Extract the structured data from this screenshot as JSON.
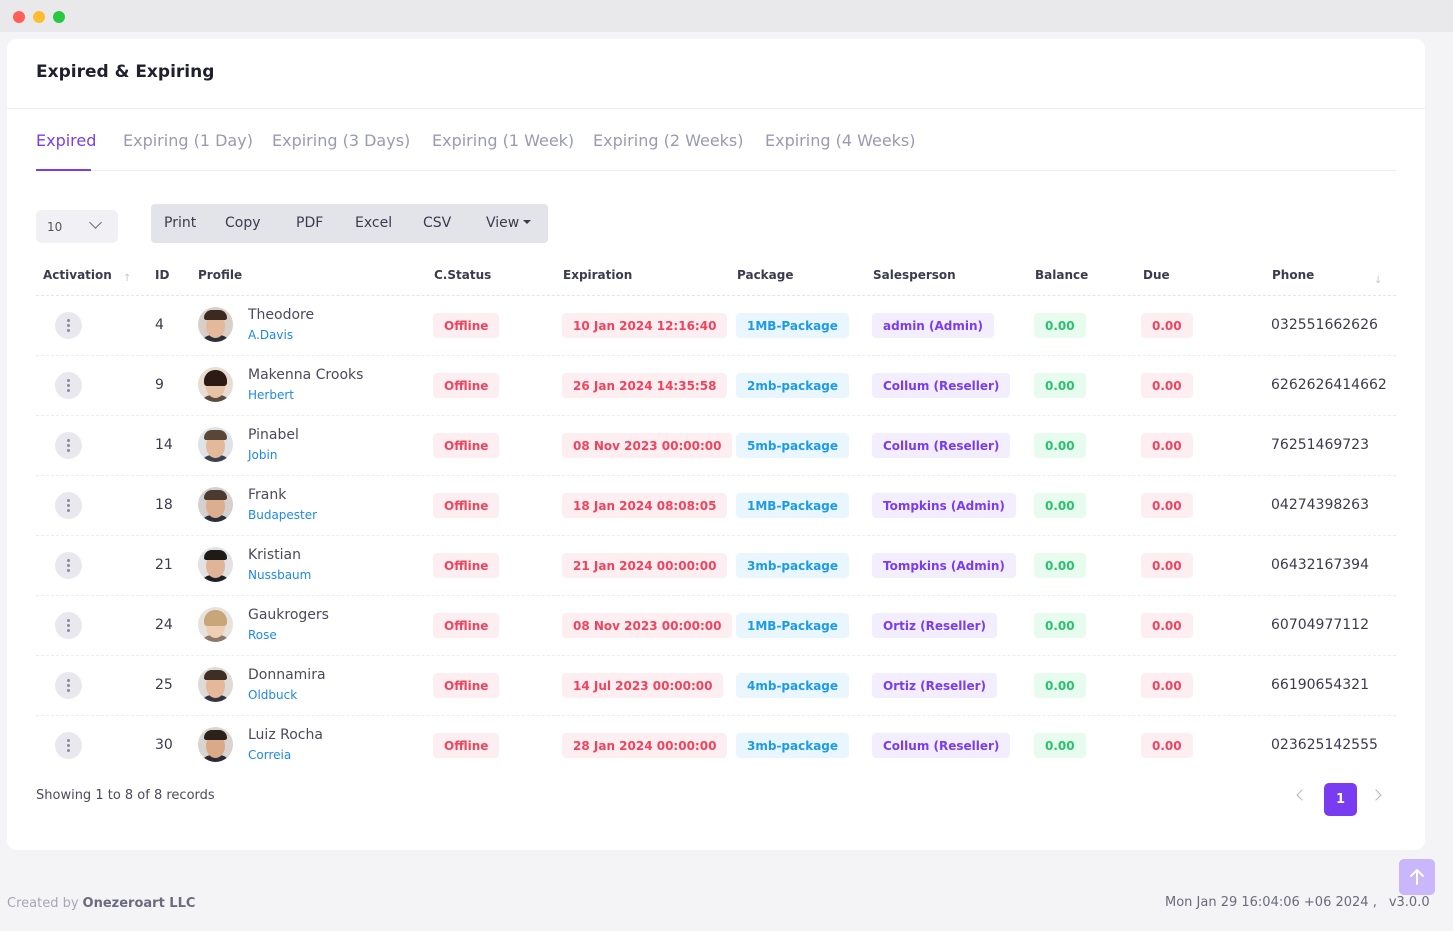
{
  "page": {
    "title": "Expired & Expiring"
  },
  "tabs": [
    {
      "label": "Expired",
      "active": true
    },
    {
      "label": "Expiring (1 Day)",
      "active": false
    },
    {
      "label": "Expiring (3 Days)",
      "active": false
    },
    {
      "label": "Expiring (1 Week)",
      "active": false
    },
    {
      "label": "Expiring (2 Weeks)",
      "active": false
    },
    {
      "label": "Expiring (4 Weeks)",
      "active": false
    }
  ],
  "toolbar": {
    "page_length": "10",
    "print_label": "Print",
    "copy_label": "Copy",
    "pdf_label": "PDF",
    "excel_label": "Excel",
    "csv_label": "CSV",
    "view_label": "View"
  },
  "table": {
    "columns": [
      "Activation",
      "ID",
      "Profile",
      "C.Status",
      "Expiration",
      "Package",
      "Salesperson",
      "Balance",
      "Due",
      "Phone"
    ],
    "rows": [
      {
        "id": "4",
        "name": "Theodore",
        "username": "A.Davis",
        "status": "Offline",
        "expiration": "10 Jan 2024 12:16:40",
        "package": "1MB-Package",
        "salesperson": "admin (Admin)",
        "balance": "0.00",
        "due": "0.00",
        "phone": "032551662626"
      },
      {
        "id": "9",
        "name": "Makenna Crooks",
        "username": "Herbert",
        "status": "Offline",
        "expiration": "26 Jan 2024 14:35:58",
        "package": "2mb-package",
        "salesperson": "Collum (Reseller)",
        "balance": "0.00",
        "due": "0.00",
        "phone": "6262626414662"
      },
      {
        "id": "14",
        "name": "Pinabel",
        "username": "Jobin",
        "status": "Offline",
        "expiration": "08 Nov 2023 00:00:00",
        "package": "5mb-package",
        "salesperson": "Collum (Reseller)",
        "balance": "0.00",
        "due": "0.00",
        "phone": "76251469723"
      },
      {
        "id": "18",
        "name": "Frank",
        "username": "Budapester",
        "status": "Offline",
        "expiration": "18 Jan 2024 08:08:05",
        "package": "1MB-Package",
        "salesperson": "Tompkins (Admin)",
        "balance": "0.00",
        "due": "0.00",
        "phone": "04274398263"
      },
      {
        "id": "21",
        "name": "Kristian",
        "username": "Nussbaum",
        "status": "Offline",
        "expiration": "21 Jan 2024 00:00:00",
        "package": "3mb-package",
        "salesperson": "Tompkins (Admin)",
        "balance": "0.00",
        "due": "0.00",
        "phone": "06432167394"
      },
      {
        "id": "24",
        "name": "Gaukrogers",
        "username": "Rose",
        "status": "Offline",
        "expiration": "08 Nov 2023 00:00:00",
        "package": "1MB-Package",
        "salesperson": "Ortiz (Reseller)",
        "balance": "0.00",
        "due": "0.00",
        "phone": "60704977112"
      },
      {
        "id": "25",
        "name": "Donnamira",
        "username": "Oldbuck",
        "status": "Offline",
        "expiration": "14 Jul 2023 00:00:00",
        "package": "4mb-package",
        "salesperson": "Ortiz (Reseller)",
        "balance": "0.00",
        "due": "0.00",
        "phone": "66190654321"
      },
      {
        "id": "30",
        "name": "Luiz Rocha",
        "username": "Correia",
        "status": "Offline",
        "expiration": "28 Jan 2024 00:00:00",
        "package": "3mb-package",
        "salesperson": "Collum (Reseller)",
        "balance": "0.00",
        "due": "0.00",
        "phone": "023625142555"
      }
    ]
  },
  "pagination": {
    "showing": "Showing 1 to 8 of 8 records",
    "current_page": "1"
  },
  "footer": {
    "created_by": "Created by",
    "company": "Onezeroart LLC",
    "datetime": "Mon Jan 29 16:04:06 +06 2024 ,",
    "version": "v3.0.0"
  },
  "colors": {
    "accent": "#7a3cf0",
    "danger": "#f0445e",
    "info": "#1e9be6",
    "success": "#27c46b"
  },
  "icons": {
    "row_action": "more-vertical-icon",
    "scroll_top": "arrow-up-icon"
  }
}
